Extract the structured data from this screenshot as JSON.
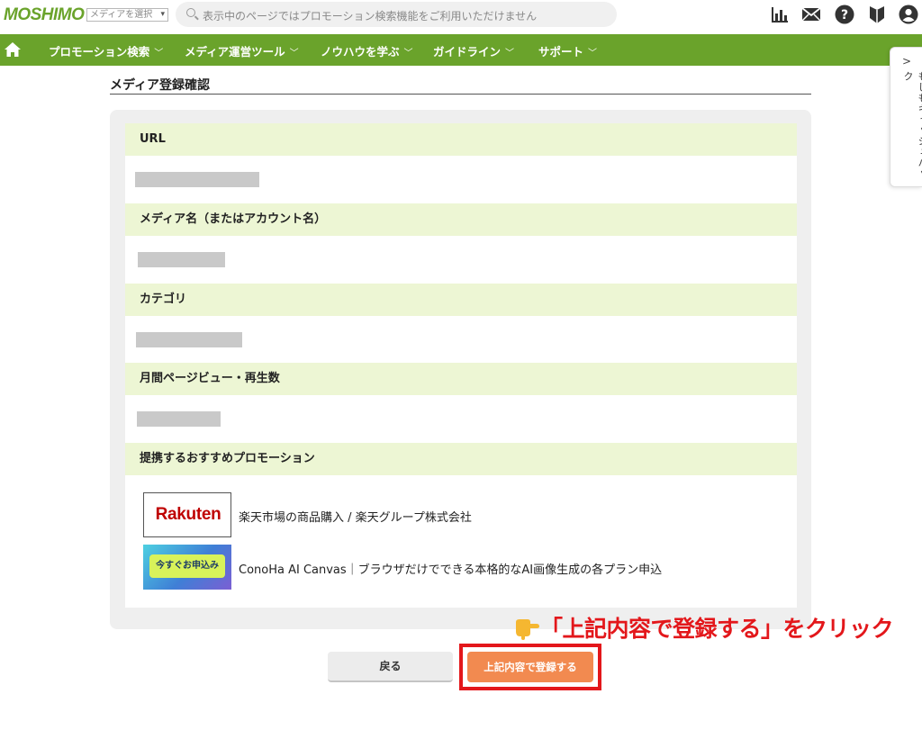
{
  "header": {
    "logo": "MOSHIMO",
    "media_select": "メディアを選択",
    "search_placeholder": "表示中のページではプロモーション検索機能をご利用いただけません"
  },
  "icons": [
    "bar-chart-icon",
    "mail-icon",
    "help-icon",
    "beginner-mark-icon",
    "user-icon"
  ],
  "nav": {
    "items": [
      {
        "label": "プロモーション検索"
      },
      {
        "label": "メディア運営ツール"
      },
      {
        "label": "ノウハウを学ぶ"
      },
      {
        "label": "ガイドライン"
      },
      {
        "label": "サポート"
      }
    ]
  },
  "side_tab": {
    "label": "もしもキャッシュバック"
  },
  "page": {
    "title": "メディア登録確認",
    "sections": [
      {
        "label": "URL"
      },
      {
        "label": "メディア名（またはアカウント名）"
      },
      {
        "label": "カテゴリ"
      },
      {
        "label": "月間ページビュー・再生数"
      },
      {
        "label": "提携するおすすめプロモーション"
      }
    ],
    "promotions": [
      {
        "logo_text": "Rakuten",
        "text": "楽天市場の商品購入 / 楽天グループ株式会社"
      },
      {
        "logo_text": "今すぐお申込み",
        "text": "ConoHa AI Canvas｜ブラウザだけでできる本格的なAI画像生成の各プラン申込"
      }
    ]
  },
  "buttons": {
    "back": "戻る",
    "submit": "上記内容で登録する"
  },
  "annotation": {
    "text": "「上記内容で登録する」をクリック"
  },
  "colors": {
    "brand_green": "#6aa32b",
    "section_bg": "#edf6d4",
    "submit_orange": "#f28a50",
    "highlight_red": "#e3171b"
  }
}
